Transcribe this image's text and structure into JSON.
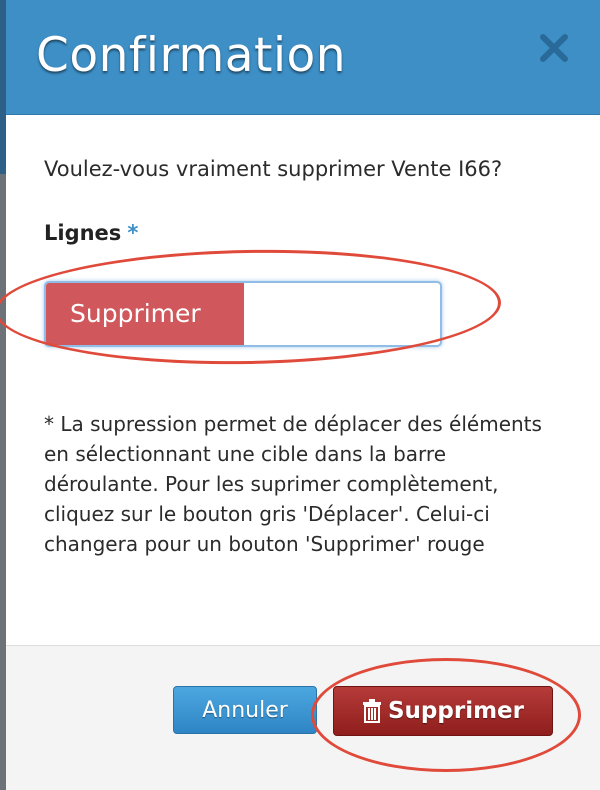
{
  "dialog": {
    "title": "Confirmation",
    "question": "Voulez-vous vraiment supprimer Vente I66?",
    "field_label": "Lignes",
    "required_marker": "*",
    "select_value": "Supprimer",
    "note": "* La supression permet de déplacer des éléments en sélectionnant une cible dans la barre déroulante. Pour les suprimer complètement, cliquez sur le bouton gris 'Déplacer'. Celui-ci changera pour un bouton 'Supprimer' rouge",
    "icons": {
      "close": "close-icon",
      "delete": "trash-icon"
    }
  },
  "footer": {
    "cancel_label": "Annuler",
    "delete_label": "Supprimer"
  },
  "colors": {
    "header": "#3d8fc6",
    "select_chip": "#d0585c",
    "delete_button": "#a62f2d",
    "cancel_button": "#3b95d3",
    "annotation": "#e04a3a"
  }
}
